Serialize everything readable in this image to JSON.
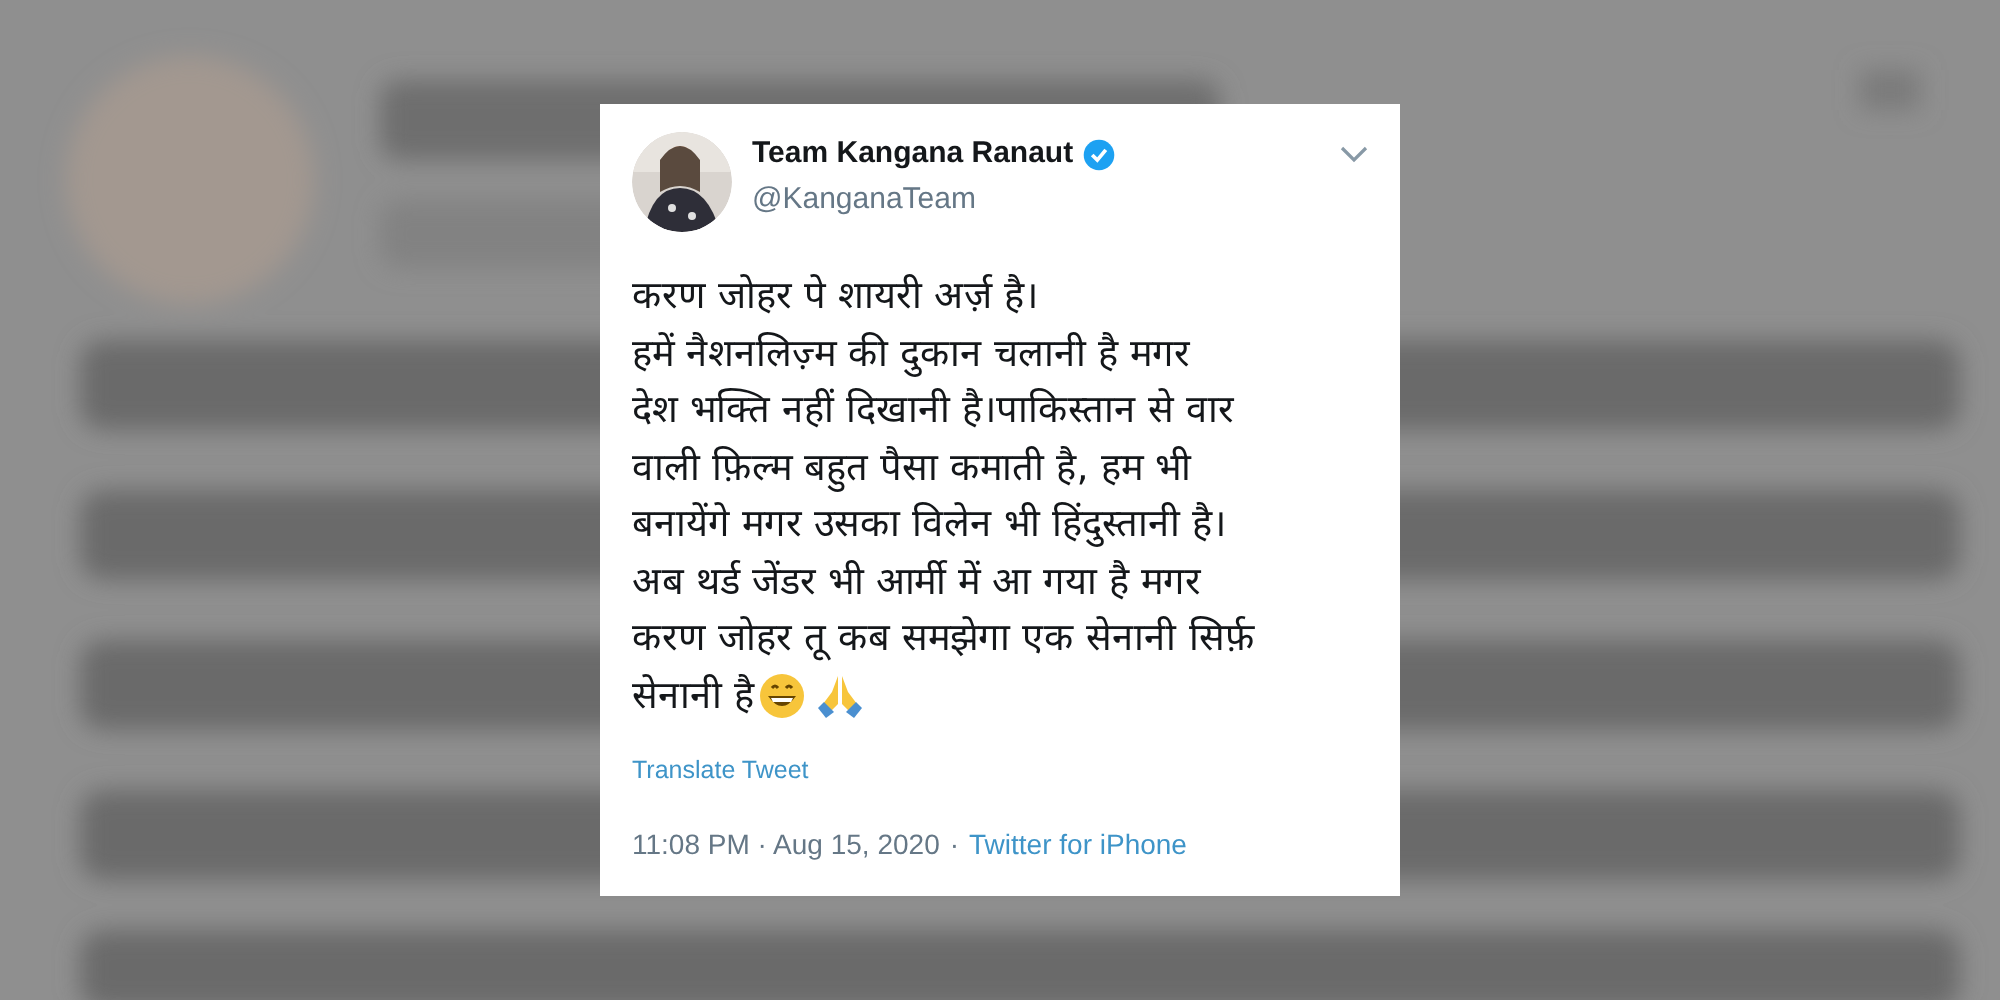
{
  "tweet": {
    "name": "Team Kangana Ranaut",
    "verified": true,
    "handle": "@KanganaTeam",
    "lines": [
      "करण जोहर पे शायरी अर्ज़ है।",
      "हमें नैशनलिज़्म की दुकान चलानी है मगर",
      "देश भक्ति नहीं दिखानी है।पाकिस्तान से वार",
      "वाली फ़िल्म बहुत पैसा कमाती है, हम भी",
      "बनायेंगे मगर उसका विलेन भी हिंदुस्तानी है।",
      "अब थर्ड जेंडर भी आर्मी में आ गया है मगर",
      "करण जोहर तू कब समझेगा एक सेनानी सिर्फ़",
      "सेनानी है"
    ],
    "translate": "Translate Tweet",
    "time": "11:08 PM · Aug 15, 2020",
    "separator": "·",
    "source": "Twitter for iPhone"
  }
}
